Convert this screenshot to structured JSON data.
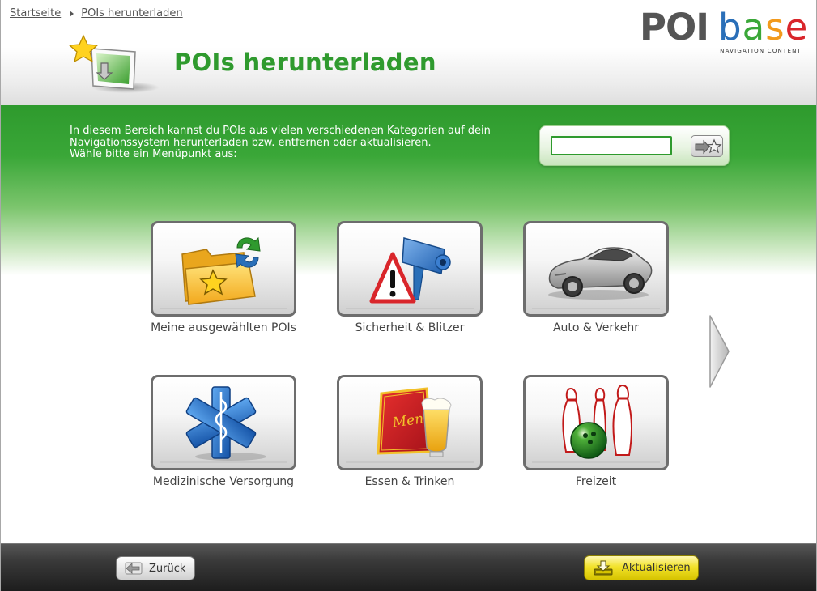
{
  "breadcrumb": {
    "home": "Startseite",
    "current": "POIs herunterladen"
  },
  "header": {
    "title": "POIs herunterladen",
    "icon": "star-download-monitor-icon"
  },
  "logo": {
    "poi": "POI",
    "base_letters": [
      "b",
      "a",
      "s",
      "e"
    ],
    "base_colors": [
      "#2a6fb8",
      "#3aa738",
      "#f29a1c",
      "#d9262b"
    ],
    "tagline": "NAVIGATION CONTENT"
  },
  "intro": {
    "line1": "In diesem Bereich kannst du POIs aus vielen verschiedenen Kategorien auf dein",
    "line2": "Navigationssystem herunterladen bzw. entfernen oder aktualisieren.",
    "line3": "Wähle bitte ein Menüpunkt aus:"
  },
  "search": {
    "value": "",
    "button_icon": "arrow-star-icon"
  },
  "categories": [
    {
      "label": "Meine ausgewählten POIs",
      "icon": "folder-star-sync-icon"
    },
    {
      "label": "Sicherheit & Blitzer",
      "icon": "speed-camera-warning-icon"
    },
    {
      "label": "Auto & Verkehr",
      "icon": "car-icon"
    },
    {
      "label": "Medizinische Versorgung",
      "icon": "star-of-life-icon"
    },
    {
      "label": "Essen & Trinken",
      "icon": "menu-beer-icon"
    },
    {
      "label": "Freizeit",
      "icon": "bowling-icon"
    }
  ],
  "menu_card_text": "Menu",
  "navigation": {
    "next_icon": "next-page-arrow-icon"
  },
  "footer": {
    "back_label": "Zurück",
    "back_icon": "arrow-left-icon",
    "update_label": "Aktualisieren",
    "update_icon": "download-tray-icon",
    "update_color": "#f2e22a"
  },
  "colors": {
    "accent_green": "#2e9a2d",
    "title_green": "#2f9a2e"
  }
}
